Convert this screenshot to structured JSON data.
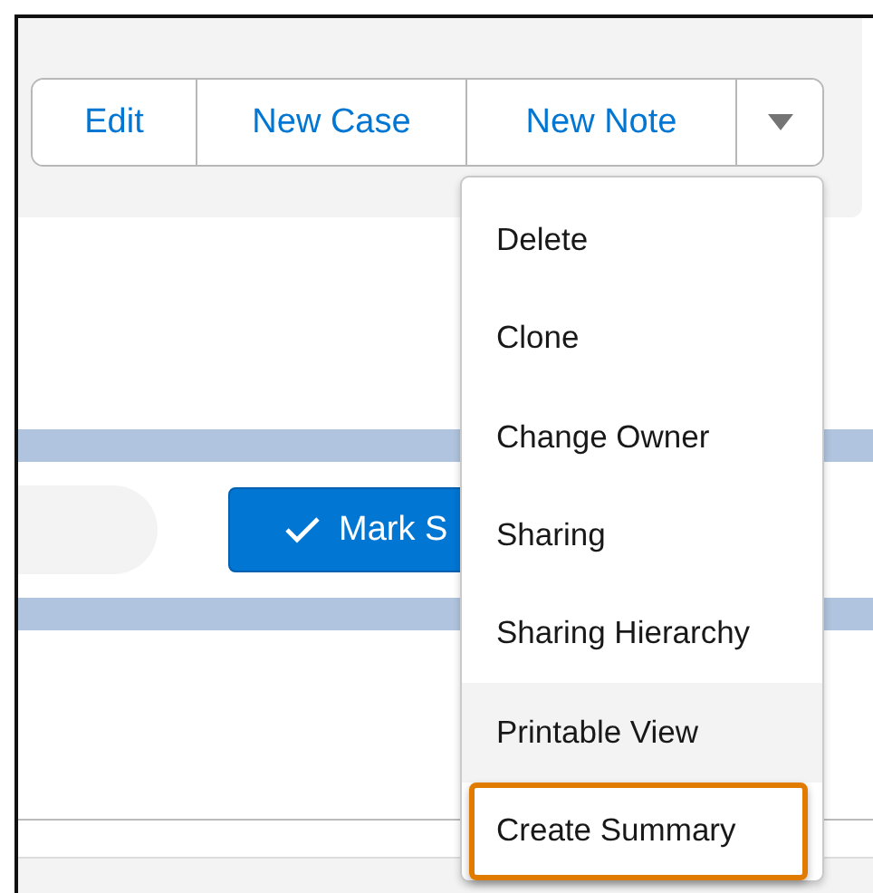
{
  "actions": [
    {
      "label": "Edit"
    },
    {
      "label": "New Case"
    },
    {
      "label": "New Note"
    }
  ],
  "action_menu": {
    "items": [
      {
        "label": "Delete",
        "hovered": false,
        "highlighted": false
      },
      {
        "label": "Clone",
        "hovered": false,
        "highlighted": false
      },
      {
        "label": "Change Owner",
        "hovered": false,
        "highlighted": false
      },
      {
        "label": "Sharing",
        "hovered": false,
        "highlighted": false
      },
      {
        "label": "Sharing Hierarchy",
        "hovered": false,
        "highlighted": false
      },
      {
        "label": "Printable View",
        "hovered": true,
        "highlighted": false
      },
      {
        "label": "Create Summary",
        "hovered": false,
        "highlighted": true
      }
    ]
  },
  "mark_button": {
    "label": "Mark S"
  }
}
